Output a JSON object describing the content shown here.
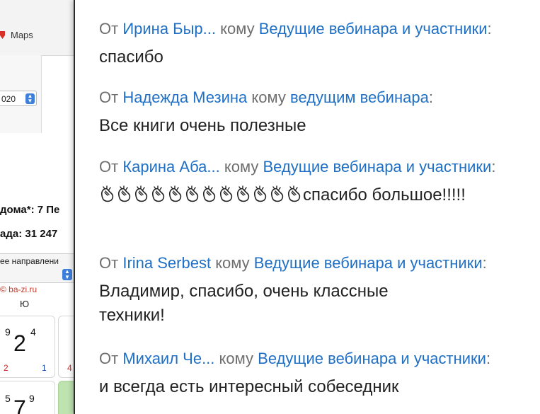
{
  "background_app": {
    "maps_label": "Maps",
    "year_value": "020",
    "bold_line_1": "дома*: 7 Пе",
    "bold_line_2": "ада: 31 247",
    "direction_select": "ее направлени",
    "copyright": "© ba-zi.ru",
    "south_label": "Ю",
    "cell_1": {
      "top_left": "9",
      "main": "2",
      "top_right": "4",
      "bottom_left": "2",
      "bottom_right": "1"
    },
    "cell_2": {
      "bottom_left": "4"
    },
    "cell_3": {
      "top_left": "5",
      "main": "7",
      "top_right": "9"
    }
  },
  "chat": {
    "from_label": "От",
    "to_label": "кому",
    "messages": [
      {
        "sender": "Ирина Быр...",
        "recipient": "Ведущие вебинара и участники",
        "text": "спасибо"
      },
      {
        "sender": "Надежда Мезина",
        "recipient": "ведущим вебинара",
        "text": "Все книги очень полезные"
      },
      {
        "sender": "Карина Аба...",
        "recipient": "Ведущие вебинара и участники",
        "clap_count": 12,
        "text": "спасибо большое!!!!!"
      },
      {
        "sender": "Irina Serbest",
        "recipient": "Ведущие вебинара и участники",
        "text_line_1": "Владимир, спасибо, очень классные",
        "text_line_2": "техники!"
      },
      {
        "sender": "Михаил Че...",
        "recipient": "Ведущие вебинара и участники",
        "text": "и всегда есть интересный собеседник"
      }
    ]
  },
  "colors": {
    "link_blue": "#1f6fc5",
    "meta_gray": "#6e6e6e",
    "message_text": "#222222"
  },
  "icons": [
    "map-pin-icon",
    "select-stepper-icon",
    "clapping-hands-icon"
  ]
}
